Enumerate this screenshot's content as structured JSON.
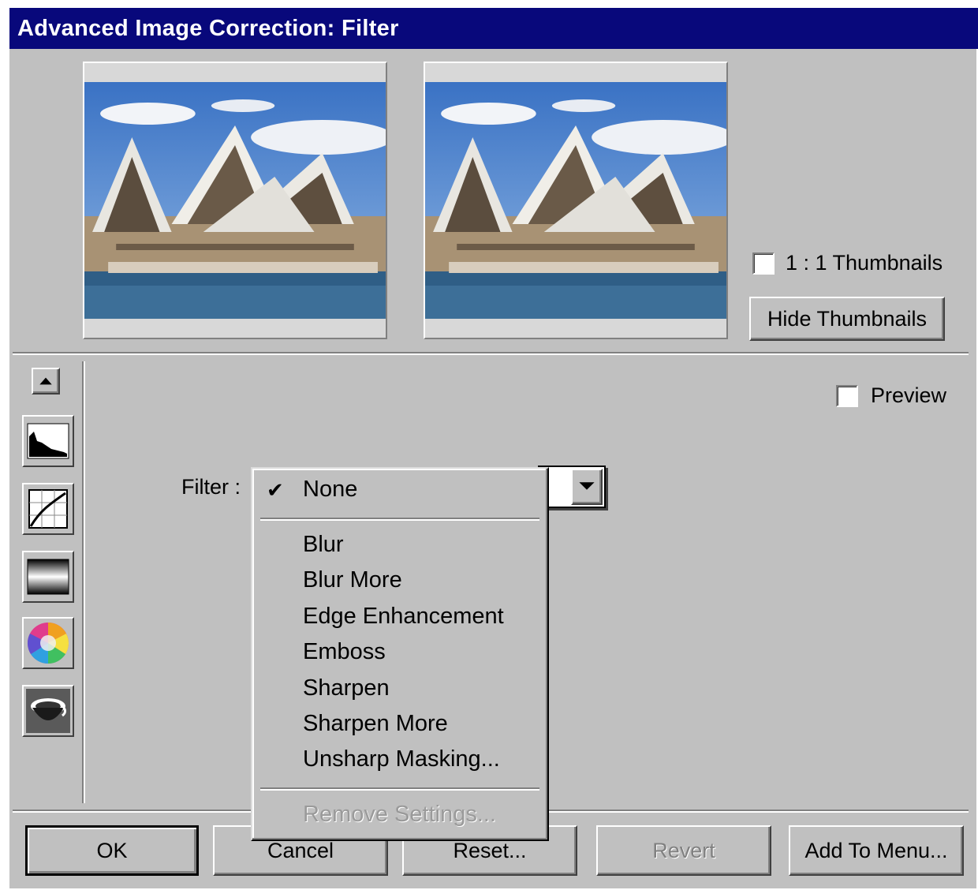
{
  "window": {
    "title": "Advanced Image Correction: Filter"
  },
  "thumbnails": {
    "one_to_one_label": "1 : 1 Thumbnails",
    "one_to_one_checked": false,
    "hide_button_label": "Hide Thumbnails"
  },
  "preview": {
    "label": "Preview",
    "checked": false
  },
  "filter": {
    "label": "Filter :",
    "selected": "None",
    "checkmark": "✔",
    "options": [
      "Blur",
      "Blur More",
      "Edge Enhancement",
      "Emboss",
      "Sharpen",
      "Sharpen More",
      "Unsharp Masking..."
    ],
    "remove_settings": "Remove Settings..."
  },
  "tools": [
    "scroll-up-icon",
    "histogram-icon",
    "curves-icon",
    "gradient-icon",
    "color-wheel-icon",
    "bowl-icon"
  ],
  "buttons": {
    "ok": "OK",
    "cancel": "Cancel",
    "reset": "Reset...",
    "revert": "Revert",
    "add_to_menu": "Add To Menu..."
  }
}
